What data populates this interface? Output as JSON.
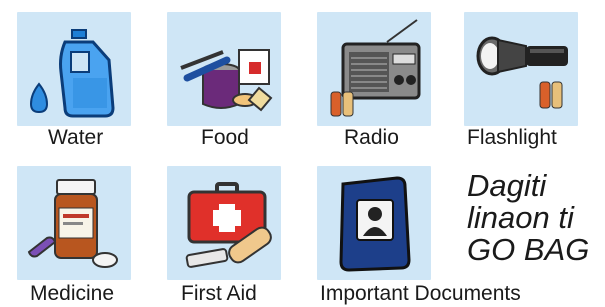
{
  "items": [
    {
      "label": "Water",
      "icon": "water-jug-icon"
    },
    {
      "label": "Food",
      "icon": "canned-food-icon"
    },
    {
      "label": "Radio",
      "icon": "radio-icon"
    },
    {
      "label": "Flashlight",
      "icon": "flashlight-icon"
    },
    {
      "label": "Medicine",
      "icon": "medicine-bottle-icon"
    },
    {
      "label": "First Aid",
      "icon": "first-aid-kit-icon"
    },
    {
      "label": "Important Documents",
      "icon": "passport-icon"
    }
  ],
  "title": {
    "lines": [
      "Dagiti",
      "linaon ti",
      "GO BAG"
    ]
  },
  "colors": {
    "tile_background": "#cfe6f6",
    "text": "#1a1a1a"
  }
}
